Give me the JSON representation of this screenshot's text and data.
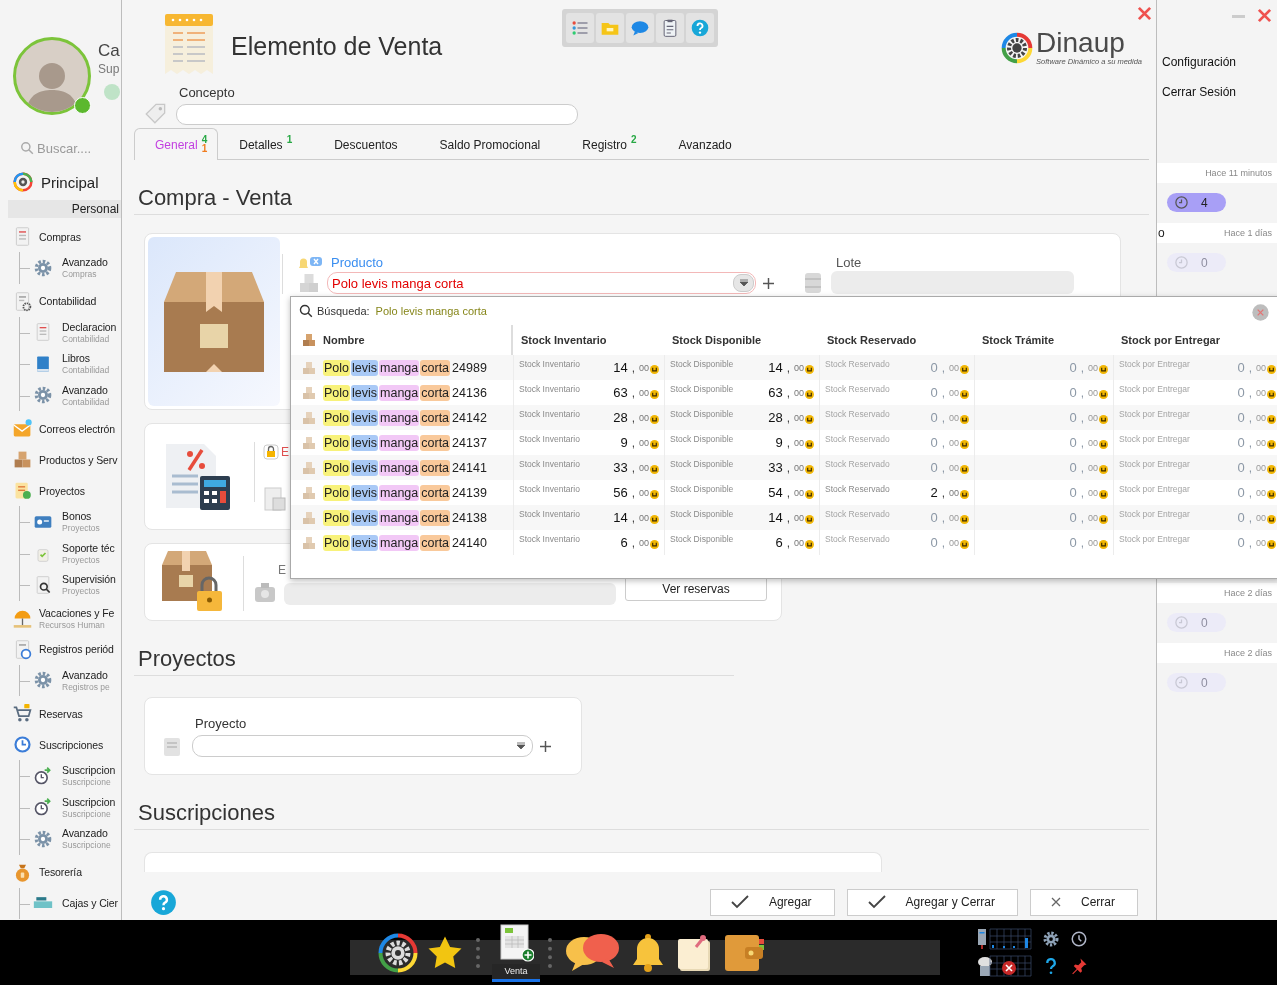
{
  "sidebar": {
    "user": {
      "name": "Ca",
      "role": "Sup"
    },
    "search": {
      "placeholder": "Buscar...."
    },
    "home": {
      "label": "Principal"
    },
    "tab": {
      "label": "Personal"
    },
    "items": [
      {
        "label": "Compras",
        "children": [
          {
            "label": "Avanzado",
            "sub": "Compras"
          }
        ]
      },
      {
        "label": "Contabilidad",
        "children": [
          {
            "label": "Declaracion",
            "sub": "Contabilidad"
          },
          {
            "label": "Libros",
            "sub": "Contabilidad"
          },
          {
            "label": "Avanzado",
            "sub": "Contabilidad"
          }
        ]
      },
      {
        "label": "Correos electrón"
      },
      {
        "label": "Productos y Serv"
      },
      {
        "label": "Proyectos",
        "children": [
          {
            "label": "Bonos",
            "sub": "Proyectos"
          },
          {
            "label": "Soporte téc",
            "sub": "Proyectos"
          },
          {
            "label": "Supervisión",
            "sub": "Proyectos"
          }
        ]
      },
      {
        "label": "Vacaciones y Fe",
        "sub": "Recursos Human"
      },
      {
        "label": "Registros periód",
        "children": [
          {
            "label": "Avanzado",
            "sub": "Registros pe"
          }
        ]
      },
      {
        "label": "Reservas"
      },
      {
        "label": "Suscripciones",
        "children": [
          {
            "label": "Suscripcion",
            "sub": "Suscripcione"
          },
          {
            "label": "Suscripcion",
            "sub": "Suscripcione"
          },
          {
            "label": "Avanzado",
            "sub": "Suscripcione"
          }
        ]
      },
      {
        "label": "Tesorería",
        "children": [
          {
            "label": "Cajas y Cier"
          }
        ]
      }
    ]
  },
  "dialog": {
    "title": "Elemento de Venta",
    "logo": {
      "name": "Dinaup",
      "tagline": "Software Dinámico a su medida"
    },
    "concept": {
      "label": "Concepto"
    },
    "tabs": [
      {
        "label": "General",
        "selected": true,
        "badges": [
          {
            "text": "4",
            "color": "#27a844"
          },
          {
            "text": "1",
            "color": "#f07c1e"
          }
        ]
      },
      {
        "label": "Detalles",
        "selected": false,
        "badges": [
          {
            "text": "1",
            "color": "#27a844"
          }
        ]
      },
      {
        "label": "Descuentos",
        "selected": false
      },
      {
        "label": "Saldo Promocional",
        "selected": false
      },
      {
        "label": "Registro",
        "selected": false,
        "badges": [
          {
            "text": "2",
            "color": "#27a844"
          }
        ]
      },
      {
        "label": "Avanzado",
        "selected": false
      }
    ],
    "sale": {
      "title": "Compra - Venta",
      "product": {
        "label": "Producto",
        "value": "Polo levis manga corta"
      },
      "lot": {
        "label": "Lote"
      },
      "tax_label": "E",
      "stock_label": "E",
      "reservations_button": "Ver reservas"
    },
    "projects": {
      "title": "Proyectos",
      "field": {
        "label": "Proyecto"
      }
    },
    "subscriptions": {
      "title": "Suscripciones"
    },
    "buttons": [
      {
        "label": "Agregar",
        "kind": "check"
      },
      {
        "label": "Agregar y Cerrar",
        "kind": "check"
      },
      {
        "label": "Cerrar",
        "kind": "close"
      }
    ]
  },
  "search_popup": {
    "label": "Búsqueda:",
    "query": "Polo levis manga corta",
    "columns": [
      "Nombre",
      "Stock Inventario",
      "Stock Disponible",
      "Stock Reservado",
      "Stock Trámite",
      "Stock por Entregar"
    ],
    "rows": [
      {
        "cells": [
          {
            "kind": "product",
            "name_parts": [
              {
                "text": "Polo",
                "color": "#f8f27a"
              },
              {
                "text": "levis",
                "color": "#a9c9f6"
              },
              {
                "text": "manga",
                "color": "#f2c8f6"
              },
              {
                "text": "corta",
                "color": "#f9c99b"
              }
            ],
            "code": "24989"
          },
          {
            "kind": "stock",
            "label": "Stock Inventario",
            "units": "14",
            "sep": ",",
            "cents": "00",
            "muted": false
          },
          {
            "kind": "stock",
            "label": "Stock Disponible",
            "units": "14",
            "sep": ",",
            "cents": "00",
            "muted": false
          },
          {
            "kind": "stock",
            "label": "Stock Reservado",
            "units": "0",
            "sep": ",",
            "cents": "00",
            "muted": true
          },
          {
            "kind": "stock",
            "units": "0",
            "sep": ",",
            "cents": "00",
            "muted": true
          },
          {
            "kind": "stock",
            "label": "Stock por Entregar",
            "units": "0",
            "sep": ",",
            "cents": "00",
            "muted": true
          }
        ]
      },
      {
        "cells": [
          {
            "kind": "product",
            "name_parts": [
              {
                "text": "Polo",
                "color": "#f8f27a"
              },
              {
                "text": "levis",
                "color": "#a9c9f6"
              },
              {
                "text": "manga",
                "color": "#f2c8f6"
              },
              {
                "text": "corta",
                "color": "#f9c99b"
              }
            ],
            "code": "24136"
          },
          {
            "kind": "stock",
            "label": "Stock Inventario",
            "units": "63",
            "sep": ",",
            "cents": "00",
            "muted": false
          },
          {
            "kind": "stock",
            "label": "Stock Disponible",
            "units": "63",
            "sep": ",",
            "cents": "00",
            "muted": false
          },
          {
            "kind": "stock",
            "label": "Stock Reservado",
            "units": "0",
            "sep": ",",
            "cents": "00",
            "muted": true
          },
          {
            "kind": "stock",
            "units": "0",
            "sep": ",",
            "cents": "00",
            "muted": true
          },
          {
            "kind": "stock",
            "label": "Stock por Entregar",
            "units": "0",
            "sep": ",",
            "cents": "00",
            "muted": true
          }
        ]
      },
      {
        "cells": [
          {
            "kind": "product",
            "name_parts": [
              {
                "text": "Polo",
                "color": "#f8f27a"
              },
              {
                "text": "levis",
                "color": "#a9c9f6"
              },
              {
                "text": "manga",
                "color": "#f2c8f6"
              },
              {
                "text": "corta",
                "color": "#f9c99b"
              }
            ],
            "code": "24142"
          },
          {
            "kind": "stock",
            "label": "Stock Inventario",
            "units": "28",
            "sep": ",",
            "cents": "00",
            "muted": false
          },
          {
            "kind": "stock",
            "label": "Stock Disponible",
            "units": "28",
            "sep": ",",
            "cents": "00",
            "muted": false
          },
          {
            "kind": "stock",
            "label": "Stock Reservado",
            "units": "0",
            "sep": ",",
            "cents": "00",
            "muted": true
          },
          {
            "kind": "stock",
            "units": "0",
            "sep": ",",
            "cents": "00",
            "muted": true
          },
          {
            "kind": "stock",
            "label": "Stock por Entregar",
            "units": "0",
            "sep": ",",
            "cents": "00",
            "muted": true
          }
        ]
      },
      {
        "cells": [
          {
            "kind": "product",
            "name_parts": [
              {
                "text": "Polo",
                "color": "#f8f27a"
              },
              {
                "text": "levis",
                "color": "#a9c9f6"
              },
              {
                "text": "manga",
                "color": "#f2c8f6"
              },
              {
                "text": "corta",
                "color": "#f9c99b"
              }
            ],
            "code": "24137"
          },
          {
            "kind": "stock",
            "label": "Stock Inventario",
            "units": "9",
            "sep": ",",
            "cents": "00",
            "muted": false
          },
          {
            "kind": "stock",
            "label": "Stock Disponible",
            "units": "9",
            "sep": ",",
            "cents": "00",
            "muted": false
          },
          {
            "kind": "stock",
            "label": "Stock Reservado",
            "units": "0",
            "sep": ",",
            "cents": "00",
            "muted": true
          },
          {
            "kind": "stock",
            "units": "0",
            "sep": ",",
            "cents": "00",
            "muted": true
          },
          {
            "kind": "stock",
            "label": "Stock por Entregar",
            "units": "0",
            "sep": ",",
            "cents": "00",
            "muted": true
          }
        ]
      },
      {
        "cells": [
          {
            "kind": "product",
            "name_parts": [
              {
                "text": "Polo",
                "color": "#f8f27a"
              },
              {
                "text": "levis",
                "color": "#a9c9f6"
              },
              {
                "text": "manga",
                "color": "#f2c8f6"
              },
              {
                "text": "corta",
                "color": "#f9c99b"
              }
            ],
            "code": "24141"
          },
          {
            "kind": "stock",
            "label": "Stock Inventario",
            "units": "33",
            "sep": ",",
            "cents": "00",
            "muted": false
          },
          {
            "kind": "stock",
            "label": "Stock Disponible",
            "units": "33",
            "sep": ",",
            "cents": "00",
            "muted": false
          },
          {
            "kind": "stock",
            "label": "Stock Reservado",
            "units": "0",
            "sep": ",",
            "cents": "00",
            "muted": true
          },
          {
            "kind": "stock",
            "units": "0",
            "sep": ",",
            "cents": "00",
            "muted": true
          },
          {
            "kind": "stock",
            "label": "Stock por Entregar",
            "units": "0",
            "sep": ",",
            "cents": "00",
            "muted": true
          }
        ]
      },
      {
        "cells": [
          {
            "kind": "product",
            "name_parts": [
              {
                "text": "Polo",
                "color": "#f8f27a"
              },
              {
                "text": "levis",
                "color": "#a9c9f6"
              },
              {
                "text": "manga",
                "color": "#f2c8f6"
              },
              {
                "text": "corta",
                "color": "#f9c99b"
              }
            ],
            "code": "24139"
          },
          {
            "kind": "stock",
            "label": "Stock Inventario",
            "units": "56",
            "sep": ",",
            "cents": "00",
            "muted": false
          },
          {
            "kind": "stock",
            "label": "Stock Disponible",
            "units": "54",
            "sep": ",",
            "cents": "00",
            "muted": false
          },
          {
            "kind": "stock",
            "label": "Stock Reservado",
            "units": "2",
            "sep": ",",
            "cents": "00",
            "muted": false
          },
          {
            "kind": "stock",
            "units": "0",
            "sep": ",",
            "cents": "00",
            "muted": true
          },
          {
            "kind": "stock",
            "label": "Stock por Entregar",
            "units": "0",
            "sep": ",",
            "cents": "00",
            "muted": true
          }
        ]
      },
      {
        "cells": [
          {
            "kind": "product",
            "name_parts": [
              {
                "text": "Polo",
                "color": "#f8f27a"
              },
              {
                "text": "levis",
                "color": "#a9c9f6"
              },
              {
                "text": "manga",
                "color": "#f2c8f6"
              },
              {
                "text": "corta",
                "color": "#f9c99b"
              }
            ],
            "code": "24138"
          },
          {
            "kind": "stock",
            "label": "Stock Inventario",
            "units": "14",
            "sep": ",",
            "cents": "00",
            "muted": false
          },
          {
            "kind": "stock",
            "label": "Stock Disponible",
            "units": "14",
            "sep": ",",
            "cents": "00",
            "muted": false
          },
          {
            "kind": "stock",
            "label": "Stock Reservado",
            "units": "0",
            "sep": ",",
            "cents": "00",
            "muted": true
          },
          {
            "kind": "stock",
            "units": "0",
            "sep": ",",
            "cents": "00",
            "muted": true
          },
          {
            "kind": "stock",
            "label": "Stock por Entregar",
            "units": "0",
            "sep": ",",
            "cents": "00",
            "muted": true
          }
        ]
      },
      {
        "cells": [
          {
            "kind": "product",
            "name_parts": [
              {
                "text": "Polo",
                "color": "#f8f27a"
              },
              {
                "text": "levis",
                "color": "#a9c9f6"
              },
              {
                "text": "manga",
                "color": "#f2c8f6"
              },
              {
                "text": "corta",
                "color": "#f9c99b"
              }
            ],
            "code": "24140"
          },
          {
            "kind": "stock",
            "label": "Stock Inventario",
            "units": "6",
            "sep": ",",
            "cents": "00",
            "muted": false
          },
          {
            "kind": "stock",
            "label": "Stock Disponible",
            "units": "6",
            "sep": ",",
            "cents": "00",
            "muted": false
          },
          {
            "kind": "stock",
            "label": "Stock Reservado",
            "units": "0",
            "sep": ",",
            "cents": "00",
            "muted": true
          },
          {
            "kind": "stock",
            "units": "0",
            "sep": ",",
            "cents": "00",
            "muted": true
          },
          {
            "kind": "stock",
            "label": "Stock por Entregar",
            "units": "0",
            "sep": ",",
            "cents": "00",
            "muted": true
          }
        ]
      }
    ]
  },
  "right_panel": {
    "links": [
      "Configuración",
      "Cerrar Sesión"
    ],
    "notifications": [
      {
        "time": "Hace 11 minutos",
        "count": "4",
        "unread": true
      },
      {
        "text": "o",
        "time": "Hace 1 días",
        "count": "0",
        "unread": false
      },
      {
        "time": "Hace 2 días",
        "count": "0",
        "unread": false
      },
      {
        "time": "Hace 2 días",
        "count": "0",
        "unread": false
      }
    ]
  },
  "taskbar": {
    "window": {
      "label": "Venta",
      "selected": true
    }
  }
}
